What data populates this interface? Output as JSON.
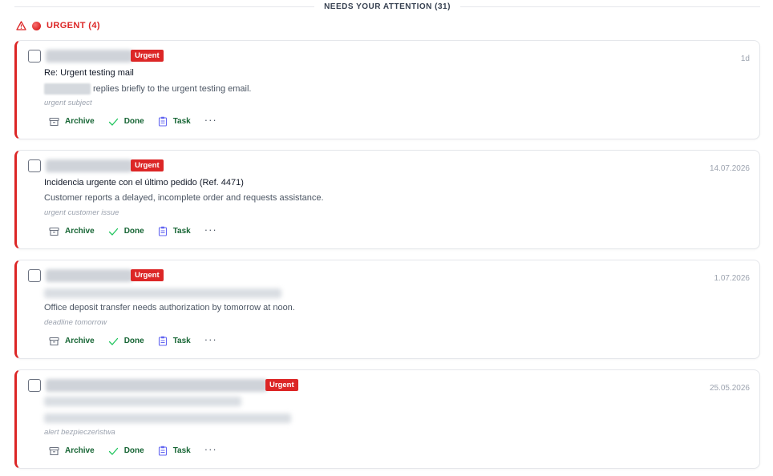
{
  "section": {
    "title": "NEEDS YOUR ATTENTION (31)"
  },
  "group": {
    "title": "URGENT (4)"
  },
  "actions": {
    "archive": "Archive",
    "done": "Done",
    "task": "Task",
    "more": "···"
  },
  "colors": {
    "urgent": "#dc2626",
    "action_text": "#166534",
    "done_icon": "#22c55e",
    "task_icon": "#6366f1"
  },
  "emails": [
    {
      "badge": "Urgent",
      "date": "1d",
      "subject": "Re: Urgent testing mail",
      "snippet": "replies briefly to the urgent testing email.",
      "tag": "urgent subject"
    },
    {
      "badge": "Urgent",
      "date": "14.07.2026",
      "subject": "Incidencia urgente con el último pedido (Ref. 4471)",
      "snippet": "Customer reports a delayed, incomplete order and requests assistance.",
      "tag": "urgent customer issue"
    },
    {
      "badge": "Urgent",
      "date": "1.07.2026",
      "subject": "",
      "snippet": "Office deposit transfer needs authorization by tomorrow at noon.",
      "tag": "deadline tomorrow"
    },
    {
      "badge": "Urgent",
      "date": "25.05.2026",
      "subject": "",
      "snippet": "",
      "tag": "alert bezpieczeństwa"
    }
  ]
}
